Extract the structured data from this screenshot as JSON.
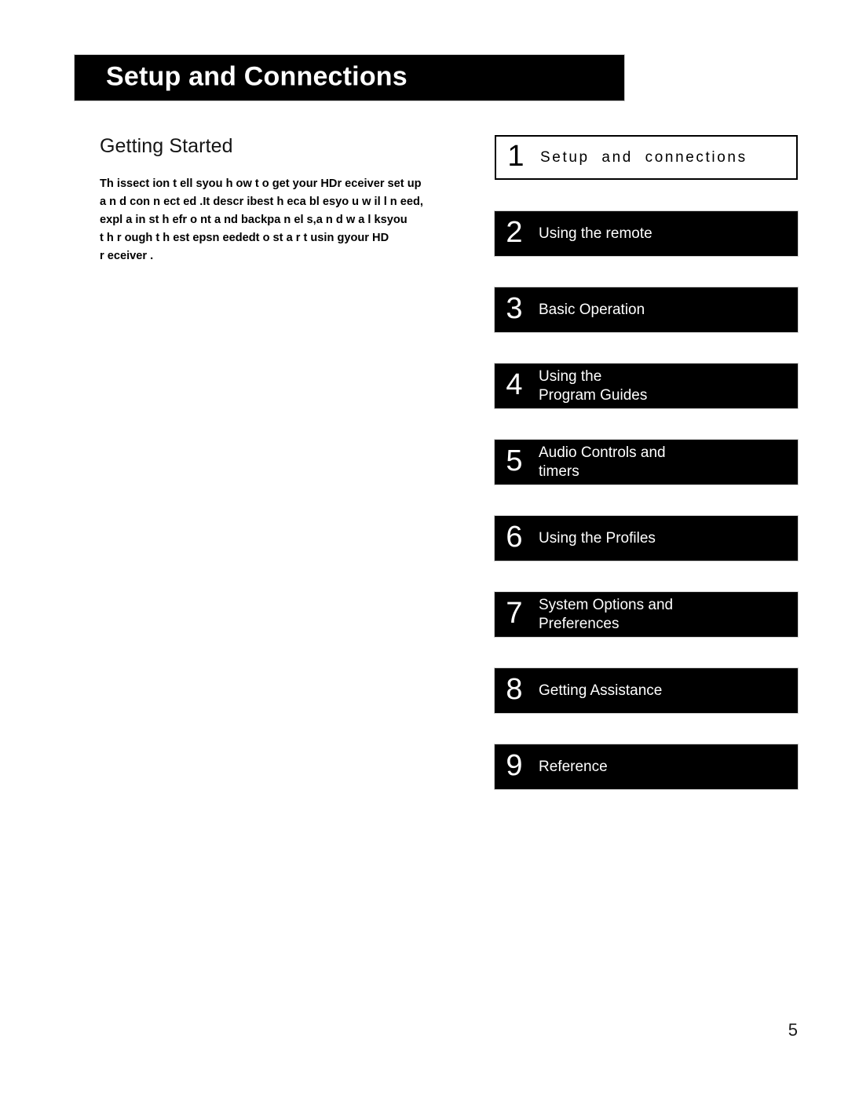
{
  "header": {
    "title": "Setup and Connections"
  },
  "left": {
    "heading": "Getting Started",
    "paragraph_lines": [
      "Th issect ion t ell syou h ow t o get your HDr eceiver set up",
      "a n d con n ect ed .It descr ibest h eca bl esyo u w il l n eed,",
      "expl a in st h efr o nt a nd backpa n el s,a n d w a l ksyou",
      "t h r ough t h est epsn eededt o st a r t usin gyour HD",
      "r eceiver ."
    ]
  },
  "chapters": [
    {
      "number": "1",
      "label_lines": [
        "Setup  and  connections"
      ],
      "style": "light"
    },
    {
      "number": "2",
      "label_lines": [
        "Using the remote"
      ],
      "style": "dark"
    },
    {
      "number": "3",
      "label_lines": [
        "Basic Operation"
      ],
      "style": "dark"
    },
    {
      "number": "4",
      "label_lines": [
        "Using the",
        "Program Guides"
      ],
      "style": "dark"
    },
    {
      "number": "5",
      "label_lines": [
        "Audio Controls and",
        "timers"
      ],
      "style": "dark"
    },
    {
      "number": "6",
      "label_lines": [
        "Using the Profiles"
      ],
      "style": "dark"
    },
    {
      "number": "7",
      "label_lines": [
        "System Options and",
        "Preferences"
      ],
      "style": "dark"
    },
    {
      "number": "8",
      "label_lines": [
        "Getting Assistance"
      ],
      "style": "dark"
    },
    {
      "number": "9",
      "label_lines": [
        "Reference"
      ],
      "style": "dark"
    }
  ],
  "footer": {
    "page_number": "5"
  }
}
